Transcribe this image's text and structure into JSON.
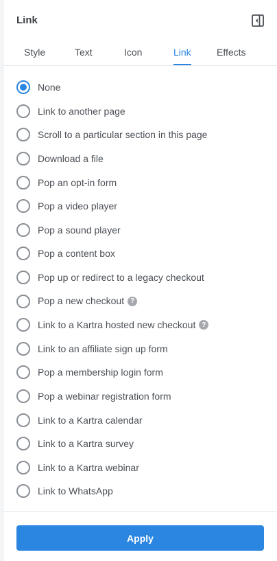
{
  "panel": {
    "title": "Link",
    "collapse_icon": "sidebar-collapse-icon"
  },
  "tabs": [
    {
      "label": "Style",
      "active": false
    },
    {
      "label": "Text",
      "active": false
    },
    {
      "label": "Icon",
      "active": false
    },
    {
      "label": "Link",
      "active": true
    },
    {
      "label": "Effects",
      "active": false
    }
  ],
  "options": [
    {
      "label": "None",
      "checked": true,
      "help": false
    },
    {
      "label": "Link to another page",
      "checked": false,
      "help": false
    },
    {
      "label": "Scroll to a particular section in this page",
      "checked": false,
      "help": false
    },
    {
      "label": "Download a file",
      "checked": false,
      "help": false
    },
    {
      "label": "Pop an opt-in form",
      "checked": false,
      "help": false
    },
    {
      "label": "Pop a video player",
      "checked": false,
      "help": false
    },
    {
      "label": "Pop a sound player",
      "checked": false,
      "help": false
    },
    {
      "label": "Pop a content box",
      "checked": false,
      "help": false
    },
    {
      "label": "Pop up or redirect to a legacy checkout",
      "checked": false,
      "help": false
    },
    {
      "label": "Pop a new checkout",
      "checked": false,
      "help": true
    },
    {
      "label": "Link to a Kartra hosted new checkout",
      "checked": false,
      "help": true
    },
    {
      "label": "Link to an affiliate sign up form",
      "checked": false,
      "help": false
    },
    {
      "label": "Pop a membership login form",
      "checked": false,
      "help": false
    },
    {
      "label": "Pop a webinar registration form",
      "checked": false,
      "help": false
    },
    {
      "label": "Link to a Kartra calendar",
      "checked": false,
      "help": false
    },
    {
      "label": "Link to a Kartra survey",
      "checked": false,
      "help": false
    },
    {
      "label": "Link to a Kartra webinar",
      "checked": false,
      "help": false
    },
    {
      "label": "Link to WhatsApp",
      "checked": false,
      "help": false
    }
  ],
  "help_glyph": "?",
  "footer": {
    "apply_label": "Apply"
  },
  "colors": {
    "accent": "#2b86e2",
    "text": "#4a4f55",
    "radio_border": "#8a8f96"
  }
}
